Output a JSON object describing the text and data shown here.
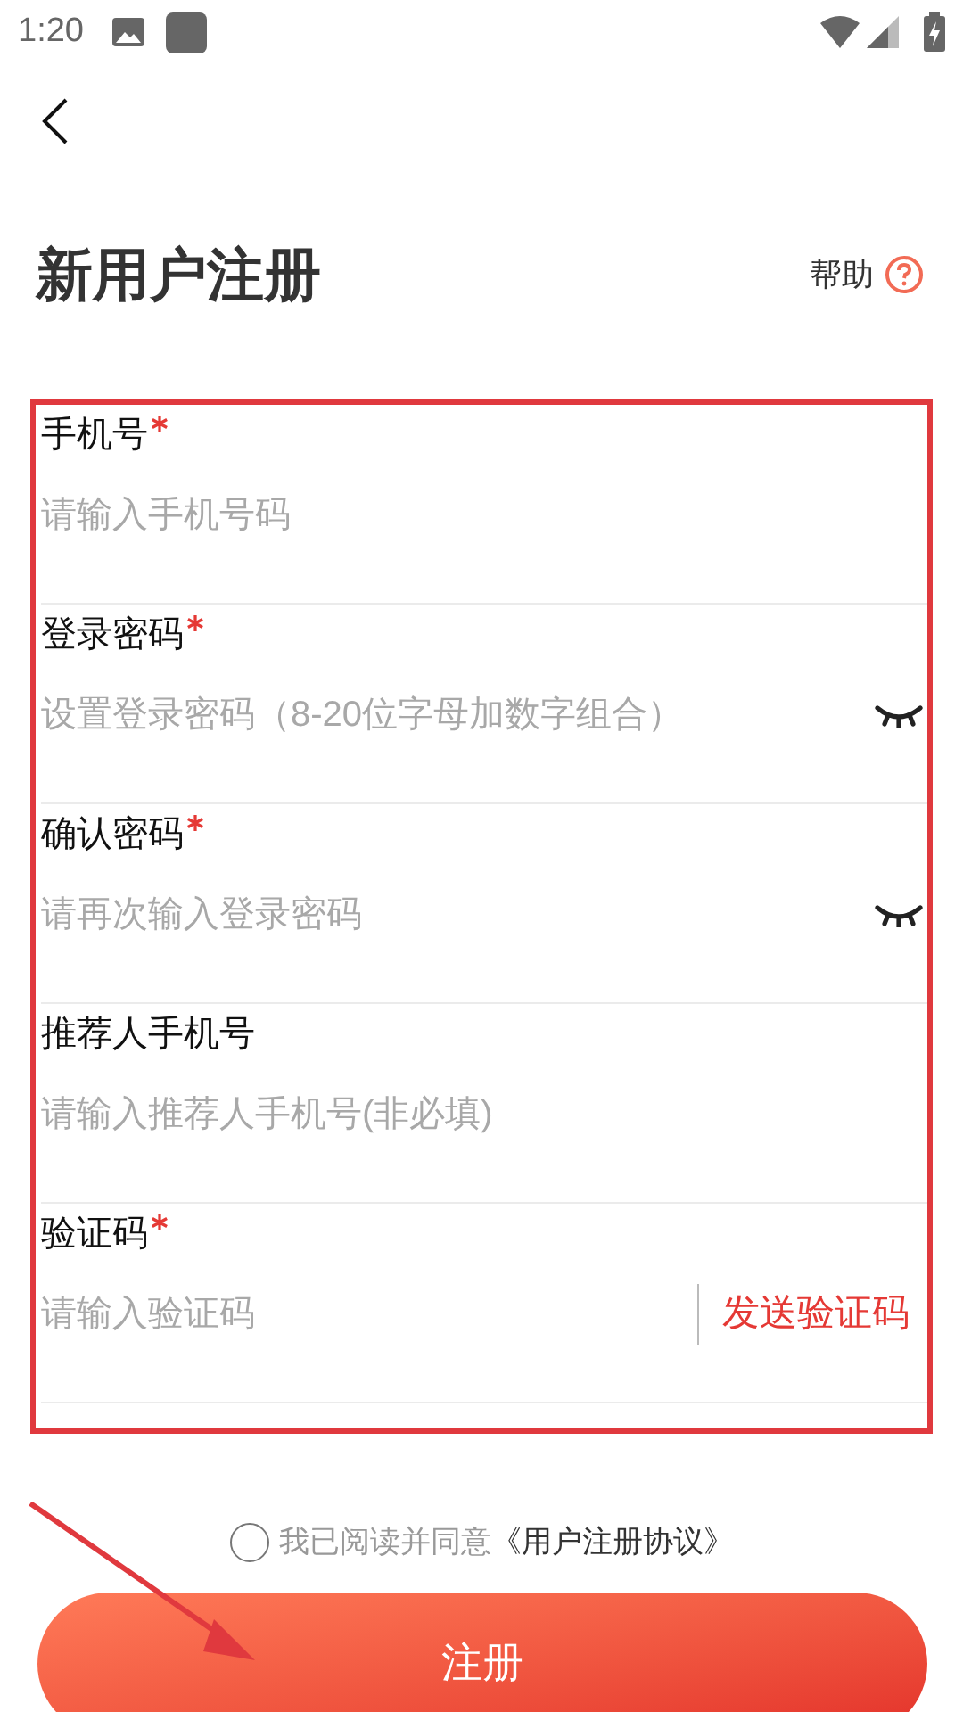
{
  "status_bar": {
    "time": "1:20"
  },
  "header": {
    "title": "新用户注册",
    "help": "帮助"
  },
  "fields": [
    {
      "kind": "text",
      "label": "手机号",
      "required": true,
      "placeholder": "请输入手机号码"
    },
    {
      "kind": "password",
      "label": "登录密码",
      "required": true,
      "placeholder": "设置登录密码（8-20位字母加数字组合）"
    },
    {
      "kind": "password",
      "label": "确认密码",
      "required": true,
      "placeholder": "请再次输入登录密码"
    },
    {
      "kind": "text",
      "label": "推荐人手机号",
      "required": false,
      "placeholder": "请输入推荐人手机号(非必填)"
    },
    {
      "kind": "code",
      "label": "验证码",
      "required": true,
      "placeholder": "请输入验证码",
      "action": "发送验证码"
    }
  ],
  "agreement": {
    "checked": false,
    "text": "我已阅读并同意",
    "link": "《用户注册协议》"
  },
  "submit": "注册"
}
